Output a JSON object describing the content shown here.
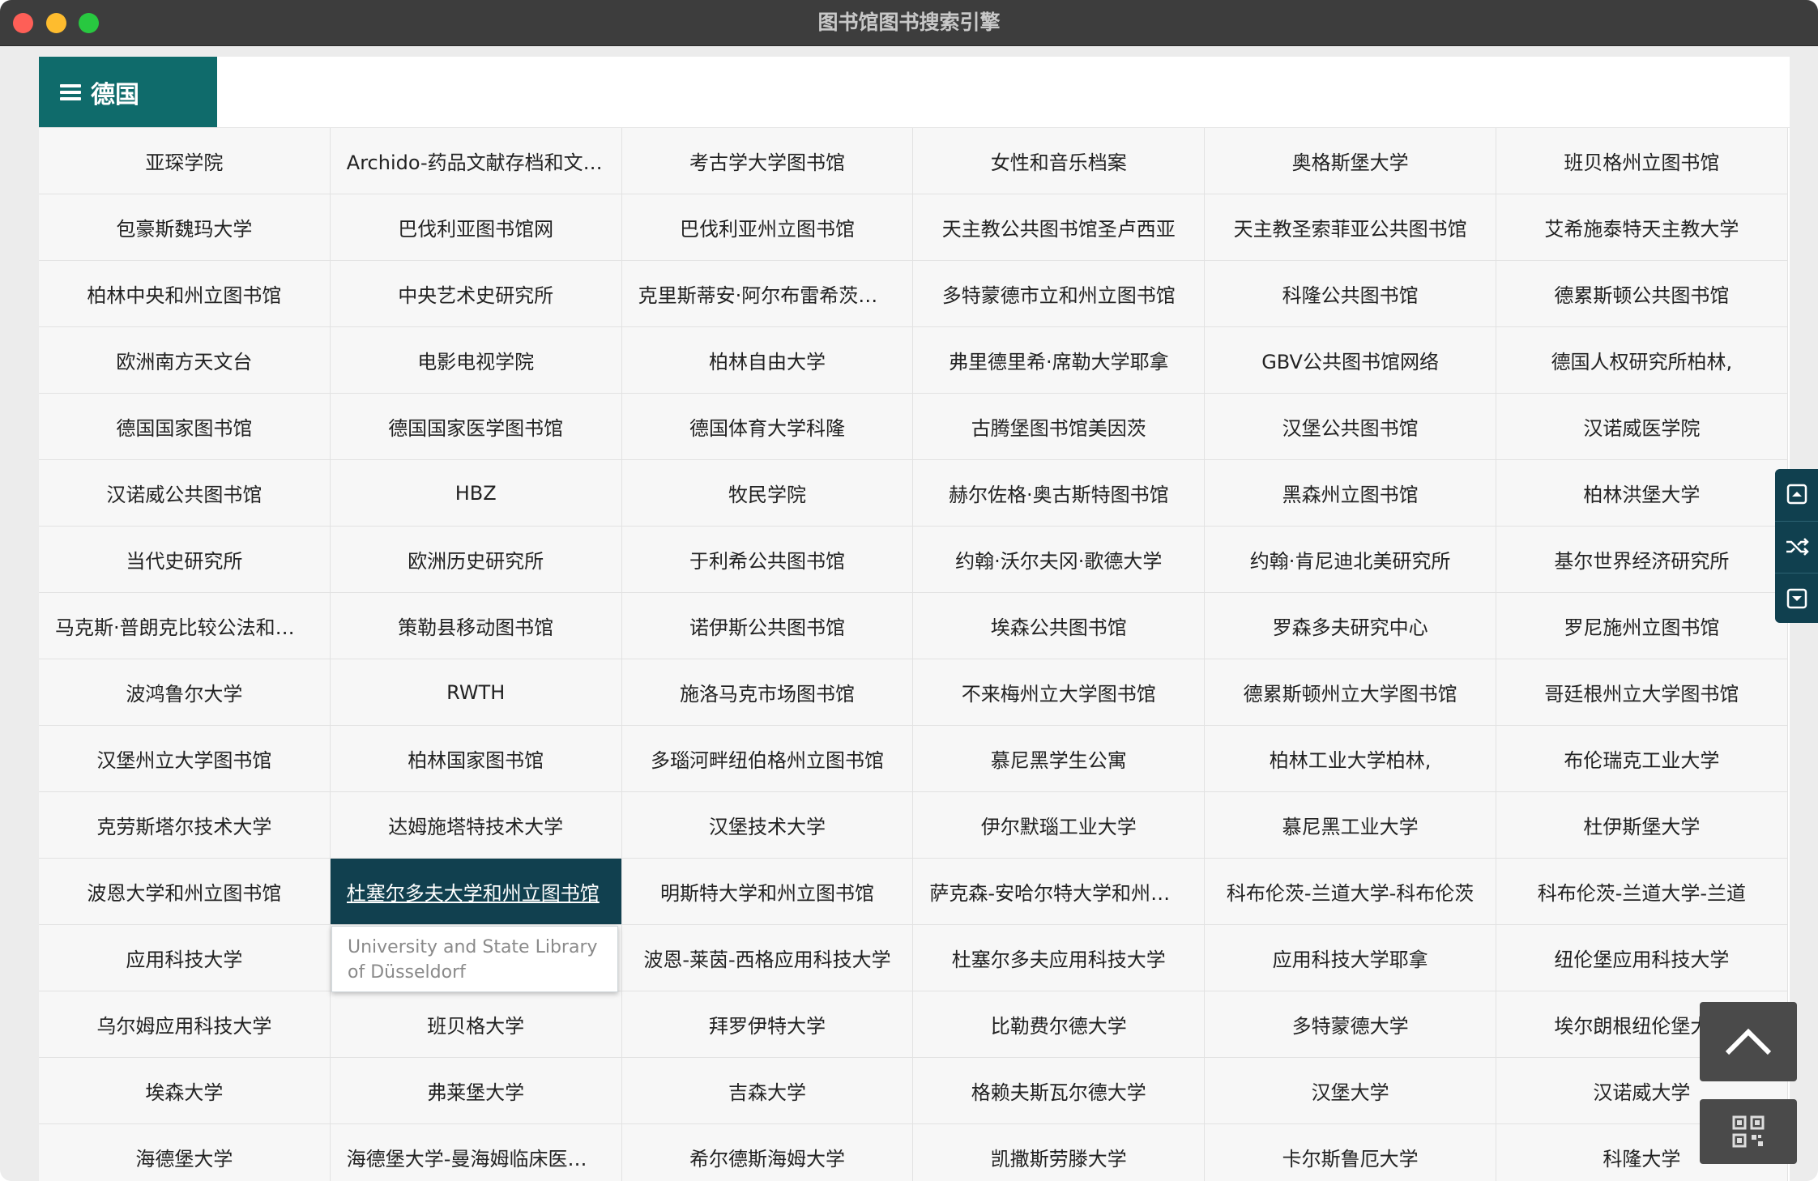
{
  "window": {
    "title": "图书馆图书搜索引擎"
  },
  "header": {
    "country": "德国"
  },
  "libraries": [
    [
      "亚琛学院",
      "Archido-药品文献存档和文献中心",
      "考古学大学图书馆",
      "女性和音乐档案",
      "奥格斯堡大学",
      "班贝格州立图书馆"
    ],
    [
      "包豪斯魏玛大学",
      "巴伐利亚图书馆网",
      "巴伐利亚州立图书馆",
      "天主教公共图书馆圣卢西亚",
      "天主教圣索菲亚公共图书馆",
      "艾希施泰特天主教大学"
    ],
    [
      "柏林中央和州立图书馆",
      "中央艺术史研究所",
      "克里斯蒂安·阿尔布雷希茨大学",
      "多特蒙德市立和州立图书馆",
      "科隆公共图书馆",
      "德累斯顿公共图书馆"
    ],
    [
      "欧洲南方天文台",
      "电影电视学院",
      "柏林自由大学",
      "弗里德里希·席勒大学耶拿",
      "GBV公共图书馆网络",
      "德国人权研究所柏林,"
    ],
    [
      "德国国家图书馆",
      "德国国家医学图书馆",
      "德国体育大学科隆",
      "古腾堡图书馆美因茨",
      "汉堡公共图书馆",
      "汉诺威医学院"
    ],
    [
      "汉诺威公共图书馆",
      "HBZ",
      "牧民学院",
      "赫尔佐格·奥古斯特图书馆",
      "黑森州立图书馆",
      "柏林洪堡大学"
    ],
    [
      "当代史研究所",
      "欧洲历史研究所",
      "于利希公共图书馆",
      "约翰·沃尔夫冈·歌德大学",
      "约翰·肯尼迪北美研究所",
      "基尔世界经济研究所"
    ],
    [
      "马克斯·普朗克比较公法和国际法研究所",
      "策勒县移动图书馆",
      "诺伊斯公共图书馆",
      "埃森公共图书馆",
      "罗森多夫研究中心",
      "罗尼施州立图书馆"
    ],
    [
      "波鸿鲁尔大学",
      "RWTH",
      "施洛马克市场图书馆",
      "不来梅州立大学图书馆",
      "德累斯顿州立大学图书馆",
      "哥廷根州立大学图书馆"
    ],
    [
      "汉堡州立大学图书馆",
      "柏林国家图书馆",
      "多瑙河畔纽伯格州立图书馆",
      "慕尼黑学生公寓",
      "柏林工业大学柏林,",
      "布伦瑞克工业大学"
    ],
    [
      "克劳斯塔尔技术大学",
      "达姆施塔特技术大学",
      "汉堡技术大学",
      "伊尔默瑙工业大学",
      "慕尼黑工业大学",
      "杜伊斯堡大学"
    ],
    [
      "波恩大学和州立图书馆",
      "杜塞尔多夫大学和州立图书馆",
      "明斯特大学和州立图书馆",
      "萨克森-安哈尔特大学和州立图书馆",
      "科布伦茨-兰道大学-科布伦茨",
      "科布伦茨-兰道大学-兰道"
    ],
    [
      "应用科技大学",
      "",
      "波恩-莱茵-西格应用科技大学",
      "杜塞尔多夫应用科技大学",
      "应用科技大学耶拿",
      "纽伦堡应用科技大学"
    ],
    [
      "乌尔姆应用科技大学",
      "班贝格大学",
      "拜罗伊特大学",
      "比勒费尔德大学",
      "多特蒙德大学",
      "埃尔朗根纽伦堡大学"
    ],
    [
      "埃森大学",
      "弗莱堡大学",
      "吉森大学",
      "格赖夫斯瓦尔德大学",
      "汉堡大学",
      "汉诺威大学"
    ],
    [
      "海德堡大学",
      "海德堡大学-曼海姆临床医学图书馆",
      "希尔德斯海姆大学",
      "凯撒斯劳滕大学",
      "卡尔斯鲁厄大学",
      "科隆大学"
    ]
  ],
  "tooltip": {
    "text": "University and State Library of Düsseldorf"
  },
  "side_tools": {
    "icons": [
      "scroll-top-icon",
      "shuffle-icon",
      "scroll-bottom-icon"
    ]
  },
  "float_buttons": {
    "icons": [
      "chevron-up-icon",
      "qr-code-icon"
    ]
  },
  "colors": {
    "accent": "#0f6b6b",
    "active_cell": "#11404f",
    "titlebar": "#3d3d3d"
  }
}
